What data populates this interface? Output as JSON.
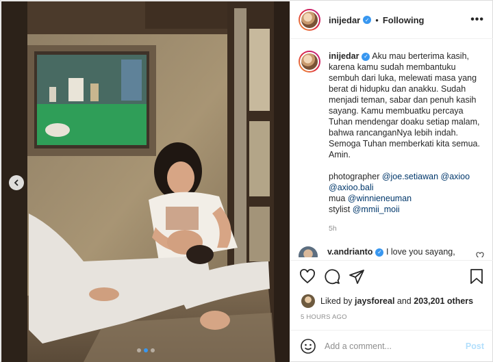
{
  "header": {
    "username": "inijedar",
    "separator": "•",
    "follow_status": "Following",
    "more": "•••"
  },
  "caption": {
    "username": "inijedar",
    "text": "Aku mau berterima kasih, karena kamu sudah membantuku sembuh dari luka, melewati masa yang berat di hidupku dan anakku. Sudah menjadi teman, sabar dan penuh kasih sayang. Kamu membuatku percaya Tuhan mendengar doaku setiap malam, bahwa rancanganNya lebih indah. Semoga Tuhan memberkati kita semua. Amin.",
    "credits": [
      {
        "label": "photographer ",
        "mentions": [
          "@joe.setiawan",
          "@axioo",
          "@axioo.bali"
        ]
      },
      {
        "label": "mua ",
        "mentions": [
          "@winnieneuman"
        ]
      },
      {
        "label": "stylist ",
        "mentions": [
          "@mmii_moii"
        ]
      }
    ],
    "time": "5h"
  },
  "comment2": {
    "username": "v.andrianto",
    "text": "I love you sayang,"
  },
  "likes": {
    "prefix": "Liked by ",
    "user": "jaysforeal",
    "middle": " and ",
    "count": "203,201 others"
  },
  "post_time": "5 HOURS AGO",
  "add_comment": {
    "placeholder": "Add a comment...",
    "post_label": "Post"
  },
  "carousel": {
    "total": 3,
    "active_index": 1
  },
  "icons": [
    "chevron-left-icon",
    "verified-icon",
    "heart-icon",
    "comment-icon",
    "share-icon",
    "bookmark-icon",
    "emoji-icon"
  ],
  "colors": {
    "accent": "#3897f0",
    "link": "#00376b",
    "post_disabled": "#b2dffc"
  }
}
